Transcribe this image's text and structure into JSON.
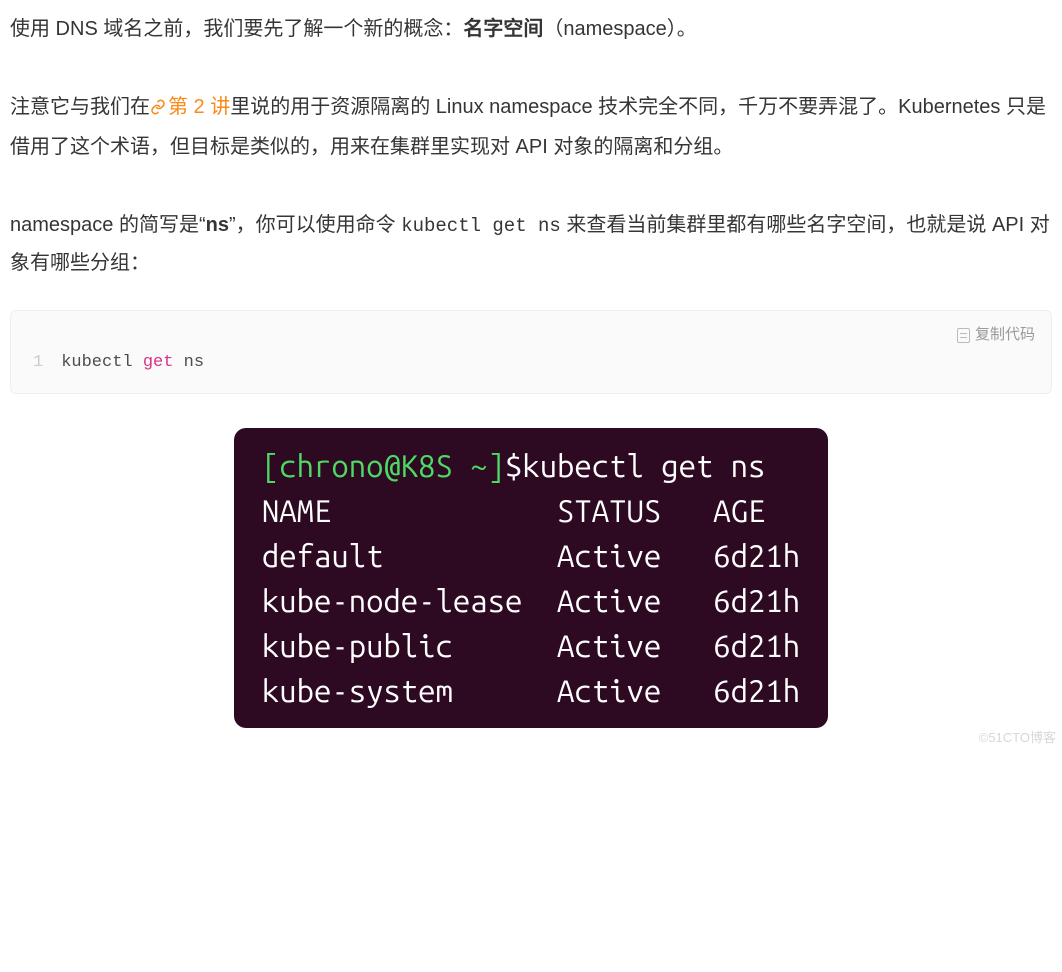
{
  "article": {
    "p1": {
      "before": "使用 DNS 域名之前，我们要先了解一个新的概念：",
      "bold": "名字空间",
      "after": "（namespace）。"
    },
    "p2": {
      "seg1": "注意它与我们在",
      "link_text": "第 2 讲",
      "seg2": "里说的用于资源隔离的 Linux namespace 技术完全不同，千万不要弄混了。Kubernetes 只是借用了这个术语，但目标是类似的，用来在集群里实现对 API 对象的隔离和分组。"
    },
    "p3": {
      "seg1": "namespace 的简写是“",
      "bold": "ns",
      "seg2": "”，你可以使用命令 ",
      "code": "kubectl get ns",
      "seg3": " 来查看当前集群里都有哪些名字空间，也就是说 API 对象有哪些分组："
    }
  },
  "code_block": {
    "copy_label": "复制代码",
    "line_no": "1",
    "tokens": {
      "t1": "kubectl ",
      "t2": "get",
      "t3": " ns"
    }
  },
  "terminal": {
    "prompt_user": "[chrono@K8S ~]",
    "prompt_symbol": "$",
    "command": "kubectl get ns",
    "header": {
      "name": "NAME",
      "status": "STATUS",
      "age": "AGE"
    },
    "rows": [
      {
        "name": "default",
        "status": "Active",
        "age": "6d21h"
      },
      {
        "name": "kube-node-lease",
        "status": "Active",
        "age": "6d21h"
      },
      {
        "name": "kube-public",
        "status": "Active",
        "age": "6d21h"
      },
      {
        "name": "kube-system",
        "status": "Active",
        "age": "6d21h"
      }
    ],
    "col_widths": {
      "name": 17,
      "status": 9
    }
  },
  "watermark": "©51CTO博客"
}
